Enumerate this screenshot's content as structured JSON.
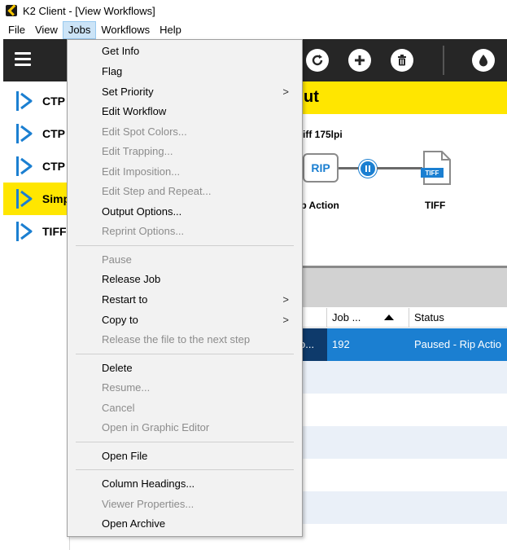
{
  "window": {
    "title": "K2 Client - [View Workflows]"
  },
  "menubar": {
    "items": [
      "File",
      "View",
      "Jobs",
      "Workflows",
      "Help"
    ],
    "active": "Jobs"
  },
  "toolbar": {
    "icons": [
      "menu-icon",
      "refresh-icon",
      "add-icon",
      "trash-icon",
      "ink-drop-icon"
    ]
  },
  "workflows": [
    {
      "label": "CTP",
      "selected": false
    },
    {
      "label": "CTP",
      "selected": false
    },
    {
      "label": "CTP",
      "selected": false
    },
    {
      "label": "Simp",
      "selected": true
    },
    {
      "label": "TIFF",
      "selected": false
    }
  ],
  "workflow_view": {
    "header_title": "ut",
    "subtitle": "iff 175lpi",
    "rip_node": "RIP",
    "tiff_badge": "TIFF",
    "rip_label": "ip Action",
    "tiff_label": "TIFF"
  },
  "jobs_table": {
    "columns": [
      "Job ...",
      "Status"
    ],
    "rows": [
      {
        "name": "o...",
        "job": "192",
        "status": "Paused - Rip Actio",
        "selected": true
      }
    ]
  },
  "jobs_menu": {
    "get_info": "Get Info",
    "flag": "Flag",
    "set_priority": "Set Priority",
    "edit_workflow": "Edit Workflow",
    "edit_spot_colors": "Edit Spot Colors...",
    "edit_trapping": "Edit Trapping...",
    "edit_imposition": "Edit Imposition...",
    "edit_step_repeat": "Edit Step and Repeat...",
    "output_options": "Output Options...",
    "reprint_options": "Reprint Options...",
    "pause": "Pause",
    "release_job": "Release Job",
    "restart_to": "Restart to",
    "copy_to": "Copy to",
    "release_next": "Release the file to the next step",
    "delete": "Delete",
    "resume": "Resume...",
    "cancel": "Cancel",
    "open_graphic_editor": "Open in Graphic Editor",
    "open_file": "Open File",
    "column_headings": "Column Headings...",
    "viewer_properties": "Viewer Properties...",
    "open_archive": "Open Archive",
    "submenu_arrow": ">"
  },
  "colors": {
    "accent_yellow": "#ffe600",
    "selection_blue": "#1b7fd1",
    "toolbar_dark": "#262626"
  }
}
